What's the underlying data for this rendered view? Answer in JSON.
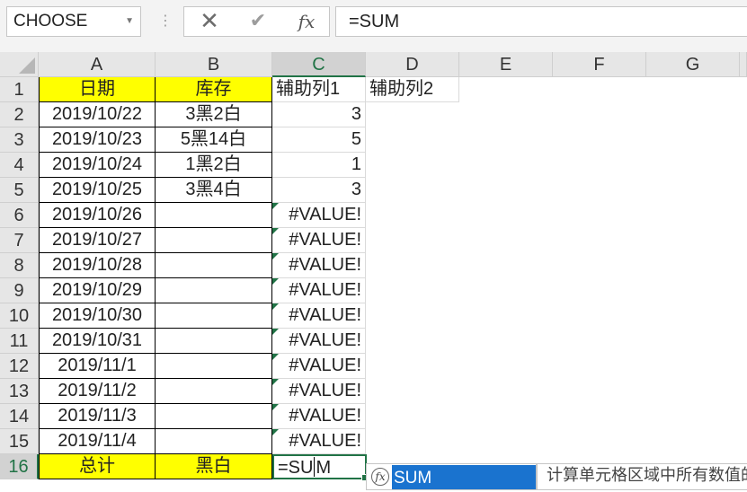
{
  "name_box": {
    "value": "CHOOSE"
  },
  "formula_bar": {
    "cancel_icon": "✕",
    "enter_icon": "✔",
    "fx_label": "fx",
    "value": "=SUM"
  },
  "columns": [
    "A",
    "B",
    "C",
    "D",
    "E",
    "F",
    "G"
  ],
  "rows": [
    "1",
    "2",
    "3",
    "4",
    "5",
    "6",
    "7",
    "8",
    "9",
    "10",
    "11",
    "12",
    "13",
    "14",
    "15",
    "16"
  ],
  "cells": {
    "header": {
      "a": "日期",
      "b": "库存",
      "c": "辅助列1",
      "d": "辅助列2"
    },
    "data": [
      {
        "a": "2019/10/22",
        "b": "3黑2白",
        "c": "3"
      },
      {
        "a": "2019/10/23",
        "b": "5黑14白",
        "c": "5"
      },
      {
        "a": "2019/10/24",
        "b": "1黑2白",
        "c": "1"
      },
      {
        "a": "2019/10/25",
        "b": "3黑4白",
        "c": "3"
      },
      {
        "a": "2019/10/26",
        "b": "",
        "c": "#VALUE!"
      },
      {
        "a": "2019/10/27",
        "b": "",
        "c": "#VALUE!"
      },
      {
        "a": "2019/10/28",
        "b": "",
        "c": "#VALUE!"
      },
      {
        "a": "2019/10/29",
        "b": "",
        "c": "#VALUE!"
      },
      {
        "a": "2019/10/30",
        "b": "",
        "c": "#VALUE!"
      },
      {
        "a": "2019/10/31",
        "b": "",
        "c": "#VALUE!"
      },
      {
        "a": "2019/11/1",
        "b": "",
        "c": "#VALUE!"
      },
      {
        "a": "2019/11/2",
        "b": "",
        "c": "#VALUE!"
      },
      {
        "a": "2019/11/3",
        "b": "",
        "c": "#VALUE!"
      },
      {
        "a": "2019/11/4",
        "b": "",
        "c": "#VALUE!"
      }
    ],
    "total": {
      "a": "总计",
      "b": "黑白",
      "c_before_cursor": "=SU",
      "c_after_cursor": "M"
    }
  },
  "autocomplete": {
    "icon": "fx",
    "item": "SUM"
  },
  "tooltip": {
    "text": "计算单元格区域中所有数值的"
  },
  "colors": {
    "header_fill": "#ffff00",
    "accent": "#217346",
    "selection": "#1a73cf"
  }
}
